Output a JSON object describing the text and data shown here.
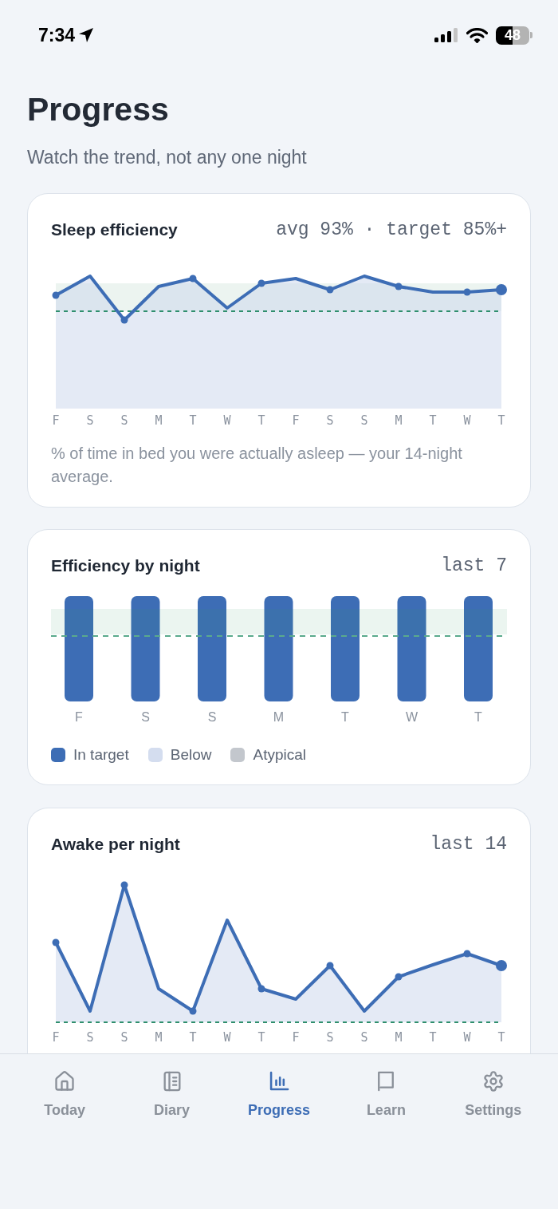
{
  "status_bar": {
    "time": "7:34",
    "battery": "48"
  },
  "header": {
    "title": "Progress",
    "subtitle": "Watch the trend, not any one night"
  },
  "cards": [
    {
      "kind": "efficiency_trend",
      "title": "Sleep efficiency",
      "meta": "avg 93% · target 85%+",
      "days": [
        "F",
        "S",
        "S",
        "M",
        "T",
        "W",
        "T",
        "F",
        "S",
        "S",
        "M",
        "T",
        "W",
        "T"
      ],
      "caption": "% of time in bed you were actually asleep — your 14-night average."
    },
    {
      "kind": "nightly_bars",
      "title": "Efficiency by night",
      "meta": "last 7",
      "bars": [
        {
          "day": "F",
          "color": "#3d6db5"
        },
        {
          "day": "S",
          "color": "#3d6db5"
        },
        {
          "day": "S",
          "color": "#3d6db5"
        },
        {
          "day": "M",
          "color": "#3d6db5"
        },
        {
          "day": "T",
          "color": "#3d6db5"
        },
        {
          "day": "W",
          "color": "#3d6db5"
        },
        {
          "day": "T",
          "color": "#3d6db5"
        }
      ],
      "legend": [
        {
          "label": "In target",
          "color": "#3d6db5"
        },
        {
          "label": "Below",
          "color": "#d4ddef"
        },
        {
          "label": "Atypical",
          "color": "#c3c7cd"
        }
      ]
    },
    {
      "kind": "awake_trend",
      "title": "Awake per night",
      "meta": "last 14",
      "days": [
        "F",
        "S",
        "S",
        "M",
        "T",
        "W",
        "T",
        "F",
        "S",
        "S",
        "M",
        "T",
        "W",
        "T"
      ]
    }
  ],
  "tabs": [
    {
      "label": "Today",
      "selected": false
    },
    {
      "label": "Diary",
      "selected": false
    },
    {
      "label": "Progress",
      "selected": true
    },
    {
      "label": "Learn",
      "selected": false
    },
    {
      "label": "Settings",
      "selected": false
    }
  ]
}
